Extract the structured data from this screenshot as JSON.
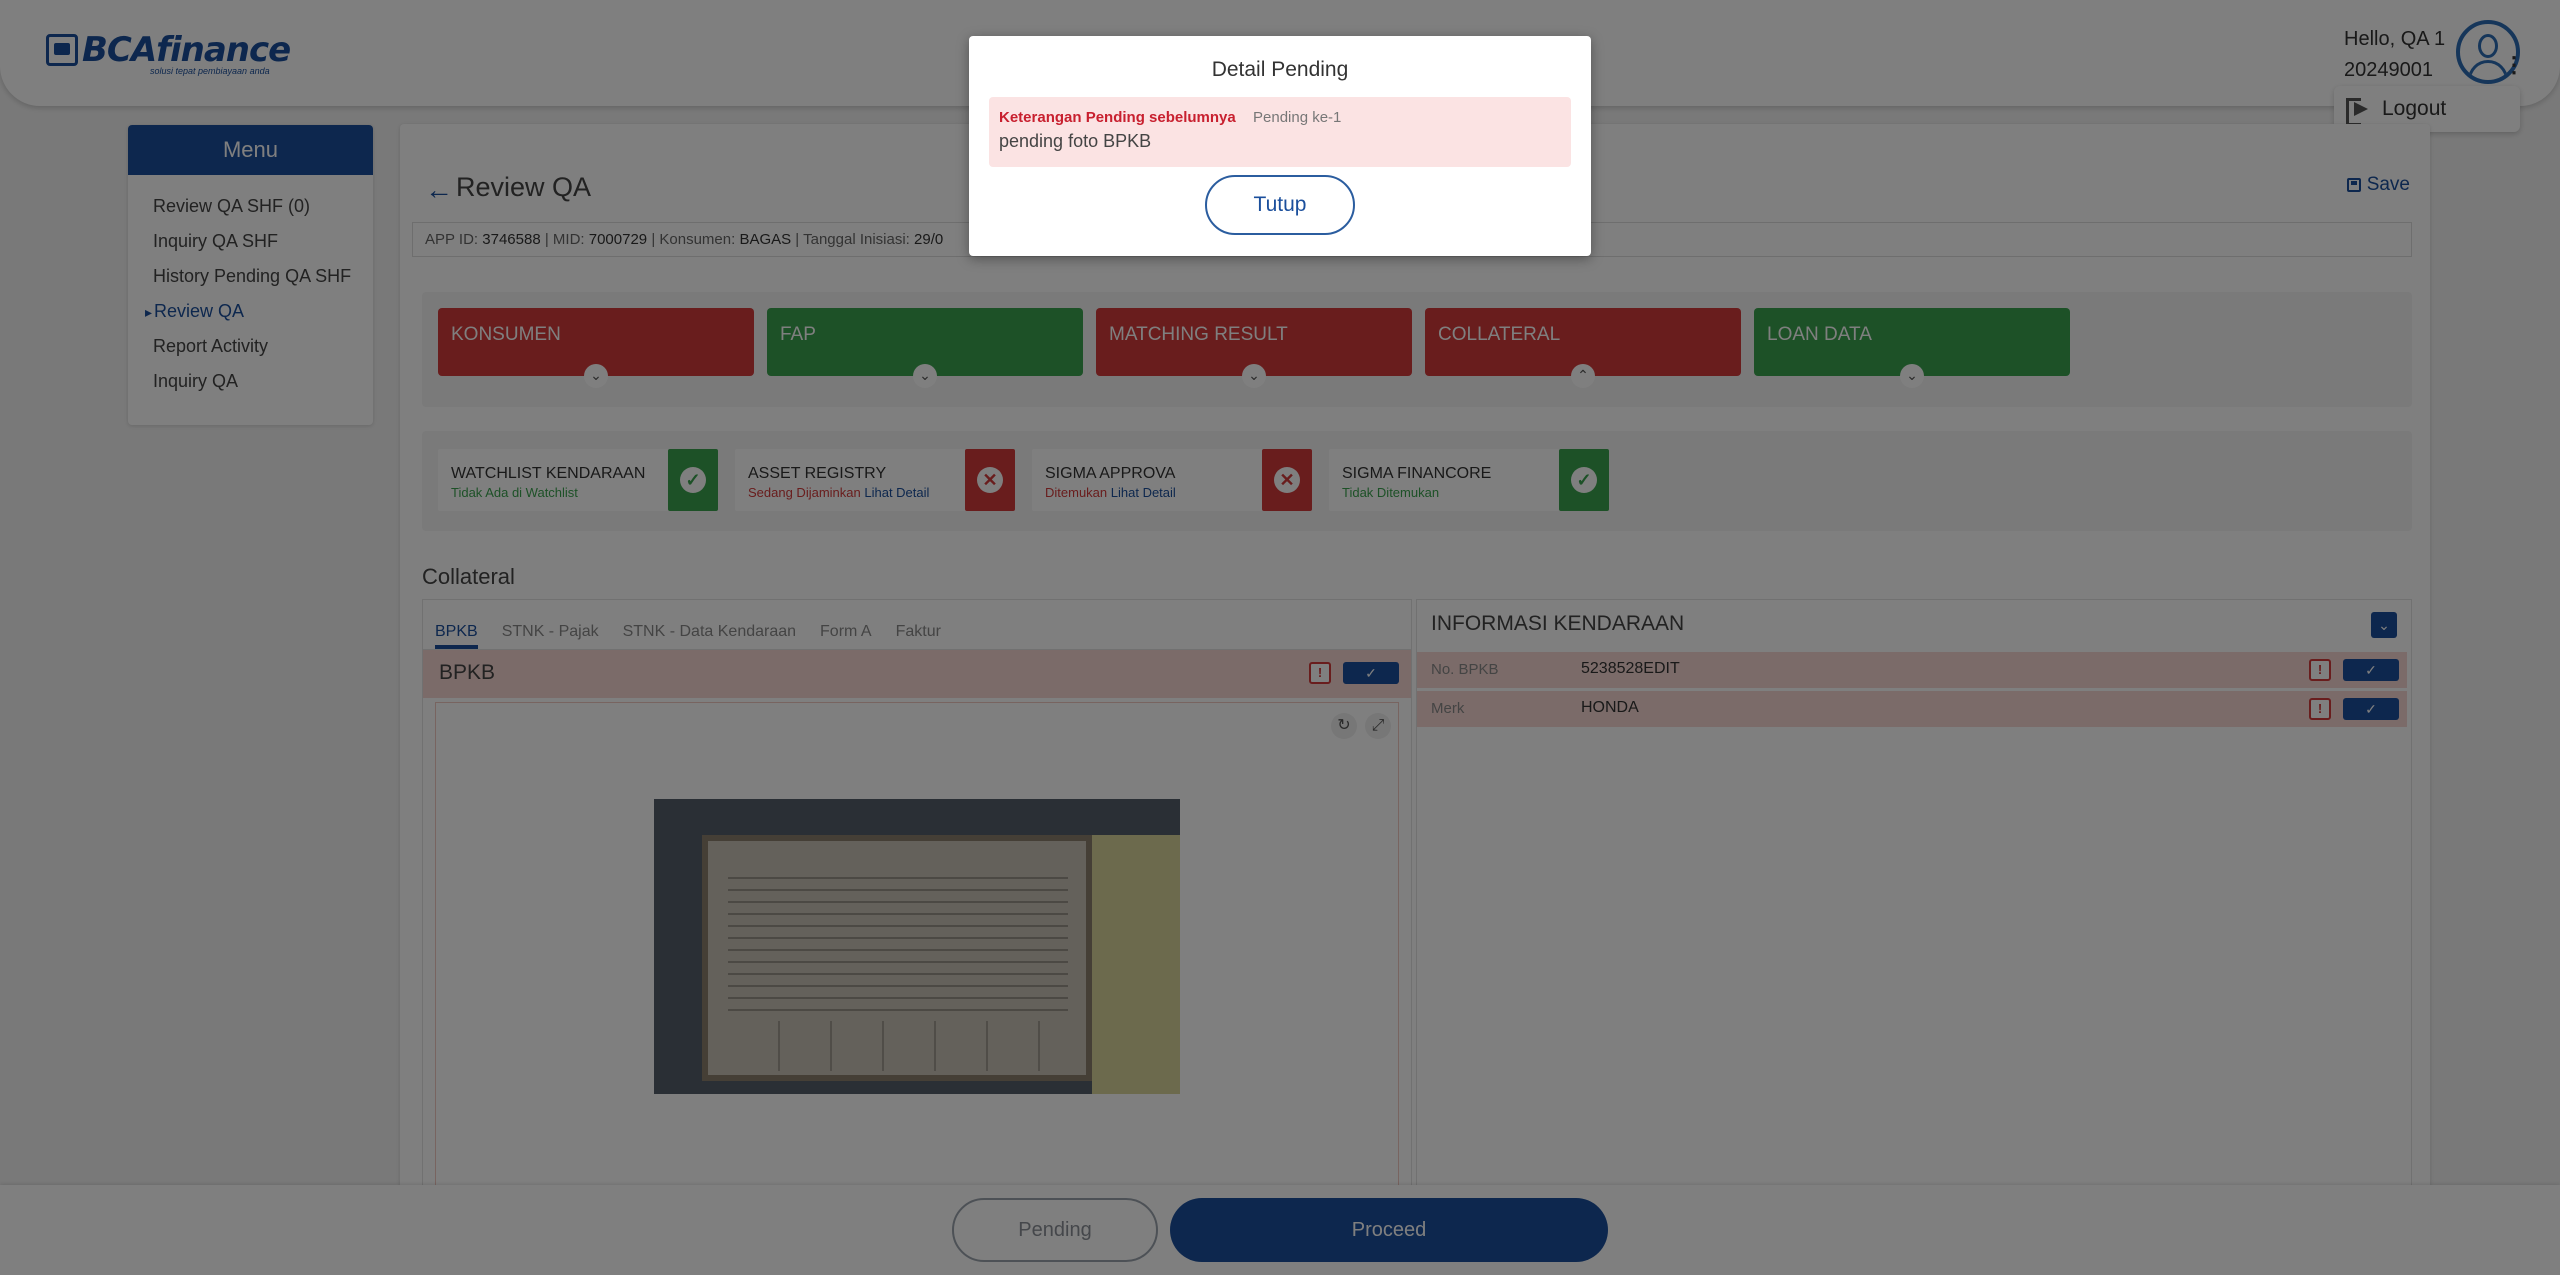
{
  "header": {
    "brand": "BCAfinance",
    "tagline": "solusi tepat pembiayaan anda",
    "greeting": "Hello, QA 1",
    "user_id": "20249001",
    "logout_label": "Logout"
  },
  "sidebar": {
    "title": "Menu",
    "items": [
      {
        "label": "Review QA SHF (0)"
      },
      {
        "label": "Inquiry QA SHF"
      },
      {
        "label": "History Pending QA SHF"
      },
      {
        "label": "Review QA"
      },
      {
        "label": "Report Activity"
      },
      {
        "label": "Inquiry QA"
      }
    ],
    "active_item": "Review QA"
  },
  "main": {
    "title": "Review QA",
    "save_label": "Save",
    "info": {
      "app_id_label": "APP ID:",
      "app_id": "3746588",
      "mid_label": "MID:",
      "mid": "7000729",
      "konsumen_label": "Konsumen:",
      "konsumen": "BAGAS",
      "tanggal_label": "Tanggal Inisiasi:",
      "tanggal": "29/0"
    },
    "categories": [
      {
        "label": "KONSUMEN",
        "status": "red",
        "chevron": "⌄"
      },
      {
        "label": "FAP",
        "status": "green",
        "chevron": "⌄"
      },
      {
        "label": "MATCHING RESULT",
        "status": "red",
        "chevron": "⌄"
      },
      {
        "label": "COLLATERAL",
        "status": "red",
        "chevron": "⌃"
      },
      {
        "label": "LOAN DATA",
        "status": "green",
        "chevron": "⌄"
      }
    ],
    "checks": [
      {
        "label": "WATCHLIST KENDARAAN",
        "sub": "Tidak Ada di Watchlist",
        "sub_color": "green",
        "link": "",
        "status": "ok"
      },
      {
        "label": "ASSET REGISTRY",
        "sub": "Sedang Dijaminkan",
        "sub_color": "red",
        "link": "Lihat Detail",
        "status": "bad"
      },
      {
        "label": "SIGMA APPROVA",
        "sub": "Ditemukan",
        "sub_color": "red",
        "link": "Lihat Detail",
        "status": "bad"
      },
      {
        "label": "SIGMA FINANCORE",
        "sub": "Tidak Ditemukan",
        "sub_color": "green",
        "link": "",
        "status": "ok"
      }
    ],
    "collateral": {
      "title": "Collateral",
      "tabs": [
        "BPKB",
        "STNK - Pajak",
        "STNK - Data Kendaraan",
        "Form A",
        "Faktur"
      ],
      "active_tab": "BPKB",
      "section_title": "BPKB",
      "info_title": "INFORMASI KENDARAAN",
      "fields": [
        {
          "label": "No. BPKB",
          "value": "5238528EDIT"
        },
        {
          "label": "Merk",
          "value": "HONDA"
        }
      ]
    }
  },
  "footer": {
    "pending_label": "Pending",
    "proceed_label": "Proceed"
  },
  "modal": {
    "title": "Detail Pending",
    "note_label": "Keterangan Pending sebelumnya",
    "note_count": "Pending ke-1",
    "note_text": "pending foto BPKB",
    "close_label": "Tutup"
  },
  "colors": {
    "primary": "#1b4f9c",
    "danger": "#d23a3a",
    "success": "#3aa24e"
  }
}
